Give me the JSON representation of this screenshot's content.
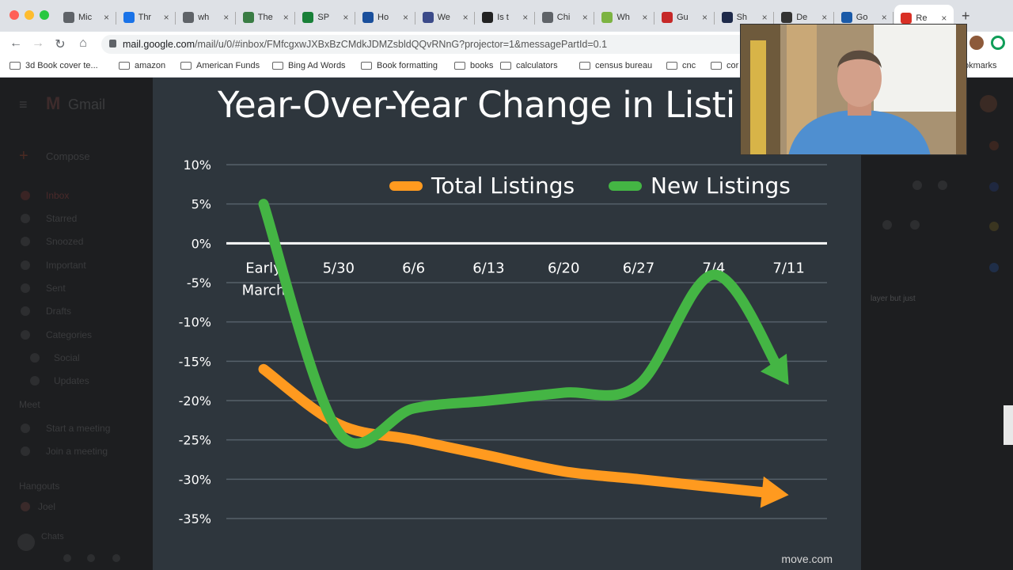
{
  "tabs": [
    {
      "label": "Mic",
      "favicon_color": "#5f6368"
    },
    {
      "label": "Thr",
      "favicon_color": "#1a73e8"
    },
    {
      "label": "wh",
      "favicon_color": "#5f6368"
    },
    {
      "label": "The",
      "favicon_color": "#3a7d44"
    },
    {
      "label": "SP",
      "favicon_color": "#188038"
    },
    {
      "label": "Ho",
      "favicon_color": "#1a4f9c"
    },
    {
      "label": "We",
      "favicon_color": "#3c4b8a"
    },
    {
      "label": "Is t",
      "favicon_color": "#222222"
    },
    {
      "label": "Chi",
      "favicon_color": "#5f6368"
    },
    {
      "label": "Wh",
      "favicon_color": "#7cb342"
    },
    {
      "label": "Gu",
      "favicon_color": "#c62828"
    },
    {
      "label": "Sh",
      "favicon_color": "#1e2a4a"
    },
    {
      "label": "De",
      "favicon_color": "#333333"
    },
    {
      "label": "Go",
      "favicon_color": "#1a5aa8"
    },
    {
      "label": "Re",
      "favicon_color": "#d93025"
    }
  ],
  "toolbar": {
    "url_host": "mail.google.com",
    "url_path": "/mail/u/0/#inbox/FMfcgxwJXBxBzCMdkJDMZsbldQQvRNnG?projector=1&messagePartId=0.1"
  },
  "bookmarks": [
    "3d Book cover te...",
    "amazon",
    "American Funds",
    "Bing Ad Words",
    "Book formatting",
    "books",
    "calculators",
    "census bureau",
    "cnc",
    "cor",
    "okmarks"
  ],
  "gmail": {
    "brand": "Gmail",
    "compose": "Compose",
    "nav": [
      "Inbox",
      "Starred",
      "Snoozed",
      "Important",
      "Sent",
      "Drafts",
      "Categories",
      "Social",
      "Updates"
    ],
    "meet_header": "Meet",
    "meet_items": [
      "Start a meeting",
      "Join a meeting"
    ],
    "hangouts_header": "Hangouts",
    "hangouts_user": "Joel",
    "no_chats": "Chats",
    "snippet": "layer but just"
  },
  "slide": {
    "title": "Year-Over-Year Change in Listi",
    "source": "move.com"
  },
  "chart_data": {
    "type": "line",
    "categories": [
      "Early March",
      "5/30",
      "6/6",
      "6/13",
      "6/20",
      "6/27",
      "7/4",
      "7/11"
    ],
    "category_lines": [
      [
        "Early",
        "March"
      ],
      [
        "5/30"
      ],
      [
        "6/6"
      ],
      [
        "6/13"
      ],
      [
        "6/20"
      ],
      [
        "6/27"
      ],
      [
        "7/4"
      ],
      [
        "7/11"
      ]
    ],
    "y_ticks": [
      10,
      5,
      0,
      -5,
      -10,
      -15,
      -20,
      -25,
      -30,
      -35
    ],
    "y_tick_labels": [
      "10%",
      "5%",
      "0%",
      "-5%",
      "-10%",
      "-15%",
      "-20%",
      "-25%",
      "-30%",
      "-35%"
    ],
    "ylim": [
      -35,
      10
    ],
    "legend_position": "top",
    "grid": true,
    "series": [
      {
        "name": "Total Listings",
        "color": "#ff9a1f",
        "values": [
          -16,
          -23,
          -25,
          -27,
          -29,
          -30,
          -31,
          -32
        ]
      },
      {
        "name": "New Listings",
        "color": "#44b544",
        "values": [
          5,
          -24,
          -21,
          -20,
          -19,
          -18,
          -4,
          -18
        ]
      }
    ]
  }
}
